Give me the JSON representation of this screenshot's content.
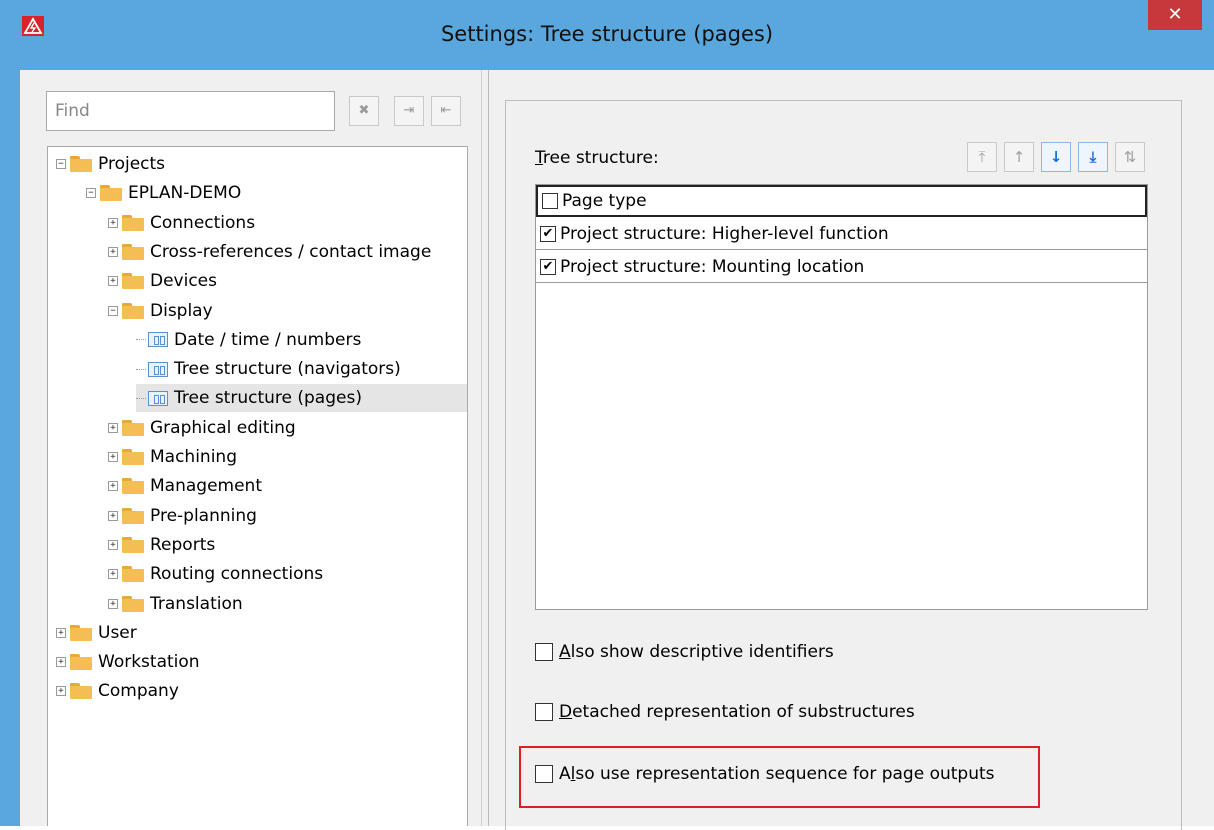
{
  "window": {
    "title": "Settings: Tree structure (pages)",
    "close_glyph": "✕"
  },
  "find": {
    "placeholder": "Find"
  },
  "find_buttons": [
    {
      "name": "clear-find-icon",
      "glyph": "✖"
    },
    {
      "name": "find-next-icon",
      "glyph": "⇥"
    },
    {
      "name": "find-prev-icon",
      "glyph": "⇤"
    }
  ],
  "tree": [
    {
      "label": "Projects",
      "icon": "folder-icon",
      "toggle": "minus"
    },
    {
      "label": "EPLAN-DEMO",
      "icon": "folder-icon",
      "toggle": "minus"
    },
    {
      "label": "Connections",
      "icon": "folder-icon",
      "toggle": "plus"
    },
    {
      "label": "Cross-references / contact image",
      "icon": "folder-icon",
      "toggle": "plus"
    },
    {
      "label": "Devices",
      "icon": "folder-icon",
      "toggle": "plus"
    },
    {
      "label": "Display",
      "icon": "folder-icon",
      "toggle": "minus"
    },
    {
      "label": "Date / time / numbers",
      "icon": "settings-page-icon"
    },
    {
      "label": "Tree structure (navigators)",
      "icon": "settings-page-icon"
    },
    {
      "label": "Tree structure (pages)",
      "icon": "settings-page-icon",
      "selected": true
    },
    {
      "label": "Graphical editing",
      "icon": "folder-icon",
      "toggle": "plus"
    },
    {
      "label": "Machining",
      "icon": "folder-icon",
      "toggle": "plus"
    },
    {
      "label": "Management",
      "icon": "folder-icon",
      "toggle": "plus"
    },
    {
      "label": "Pre-planning",
      "icon": "folder-icon",
      "toggle": "plus"
    },
    {
      "label": "Reports",
      "icon": "folder-icon",
      "toggle": "plus"
    },
    {
      "label": "Routing connections",
      "icon": "folder-icon",
      "toggle": "plus"
    },
    {
      "label": "Translation",
      "icon": "folder-icon",
      "toggle": "plus"
    },
    {
      "label": "User",
      "icon": "folder-icon",
      "toggle": "plus"
    },
    {
      "label": "Workstation",
      "icon": "folder-icon",
      "toggle": "plus"
    },
    {
      "label": "Company",
      "icon": "folder-icon",
      "toggle": "plus"
    }
  ],
  "tree_structure": {
    "label_first": "T",
    "label_rest": "ree structure:",
    "tools": [
      {
        "name": "move-top-icon",
        "glyph": "⤒",
        "enabled": false
      },
      {
        "name": "move-up-icon",
        "glyph": "↑",
        "enabled": false
      },
      {
        "name": "move-down-icon",
        "glyph": "↓",
        "enabled": true
      },
      {
        "name": "move-bottom-icon",
        "glyph": "⤓",
        "enabled": true
      },
      {
        "name": "sort-icon",
        "glyph": "⇅",
        "enabled": false
      }
    ],
    "rows": [
      {
        "label": "Page type",
        "checked": false,
        "focused": true
      },
      {
        "label": "Project structure: Higher-level function",
        "checked": true
      },
      {
        "label": "Project structure: Mounting location",
        "checked": true
      }
    ],
    "check_glyph": "✔"
  },
  "options": [
    {
      "pre": "",
      "u": "A",
      "post": "lso show descriptive identifiers",
      "checked": false
    },
    {
      "pre": "",
      "u": "D",
      "post": "etached representation of substructures",
      "checked": false
    },
    {
      "pre": "A",
      "u": "l",
      "post": "so use representation sequence for page outputs",
      "checked": false
    }
  ],
  "colors": {
    "titlebar": "#5aa7dd",
    "close": "#c7383a",
    "highlight": "#e02020",
    "folder": "#f5be55"
  }
}
